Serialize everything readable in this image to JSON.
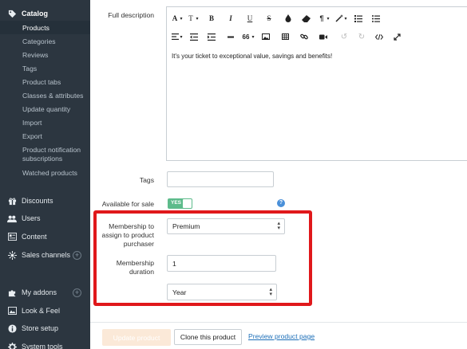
{
  "sidebar": {
    "catalog_label": "Catalog",
    "catalog_items": [
      "Products",
      "Categories",
      "Reviews",
      "Tags",
      "Product tabs",
      "Classes & attributes",
      "Update quantity",
      "Import",
      "Export",
      "Product notification subscriptions",
      "Watched products"
    ],
    "sections": {
      "discounts": "Discounts",
      "users": "Users",
      "content": "Content",
      "sales_channels": "Sales channels",
      "my_addons": "My addons",
      "look_feel": "Look & Feel",
      "store_setup": "Store setup",
      "system_tools": "System tools"
    },
    "plus_symbol": "+"
  },
  "form": {
    "full_description_label": "Full description",
    "editor_text": "It's your ticket to exceptional value, savings and benefits!",
    "toolbar": {
      "font": "A",
      "size": "T",
      "bold": "B",
      "italic": "I",
      "underline": "U",
      "strike": "S",
      "pilcrow": "¶",
      "quote": "66"
    },
    "tags_label": "Tags",
    "tags_value": "",
    "available_label": "Available for sale",
    "available_toggle": "YES",
    "help_symbol": "?",
    "membership_label": "Membership to assign to product purchaser",
    "membership_value": "Premium",
    "duration_label": "Membership duration",
    "duration_value": "1",
    "period_value": "Year"
  },
  "footer": {
    "update_label": "Update product",
    "clone_label": "Clone this product",
    "preview_label": "Preview product page"
  },
  "colors": {
    "sidebar_bg": "#2c3640",
    "highlight": "#e0181b",
    "toggle_on": "#5dbb8b",
    "link": "#1d6fb8",
    "update_button": "#fbe9d8"
  }
}
